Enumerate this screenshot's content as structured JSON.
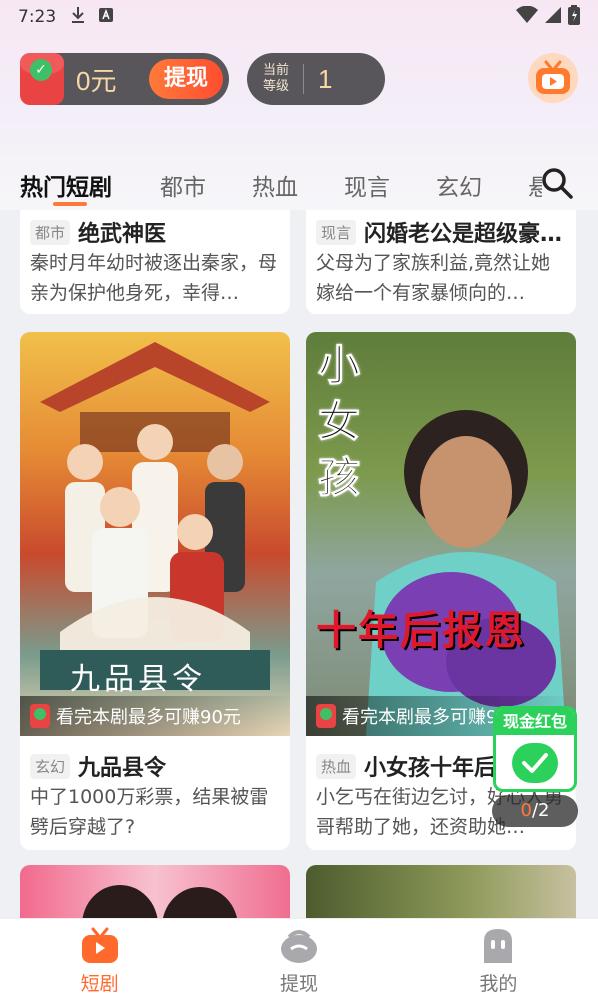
{
  "status_bar": {
    "time": "7:23"
  },
  "header": {
    "cash_amount": "0元",
    "withdraw_label": "提现",
    "level_label": "当前\n等级",
    "level_value": "1"
  },
  "tabs": [
    {
      "label": "热门短剧",
      "active": true
    },
    {
      "label": "都市"
    },
    {
      "label": "热血"
    },
    {
      "label": "现言"
    },
    {
      "label": "玄幻"
    },
    {
      "label": "悬"
    }
  ],
  "cards": [
    {
      "genre": "都市",
      "title": "绝武神医",
      "desc": "秦时月年幼时被逐出秦家，母亲为保护他身死，幸得…"
    },
    {
      "genre": "现言",
      "title": "闪婚老公是超级豪…",
      "desc": "父母为了家族利益,竟然让她嫁给一个有家暴倾向的…"
    },
    {
      "genre": "玄幻",
      "title": "九品县令",
      "desc": "中了1000万彩票，结果被雷劈后穿越了?",
      "earn_text": "看完本剧最多可赚90元",
      "cover_text": "九品县令"
    },
    {
      "genre": "热血",
      "title": "小女孩十年后报恩",
      "desc": "小乞丐在街边乞讨，好心人勇哥帮助了她，还资助她…",
      "earn_text": "看完本剧最多可赚90元",
      "cover_text_top": "小女孩",
      "cover_text_bottom": "十年后报恩"
    }
  ],
  "floating_red_packet": {
    "label": "现金红包",
    "progress_current": "0",
    "progress_total": "/2"
  },
  "bottom_nav": [
    {
      "label": "短剧",
      "active": true
    },
    {
      "label": "提现"
    },
    {
      "label": "我的"
    }
  ]
}
